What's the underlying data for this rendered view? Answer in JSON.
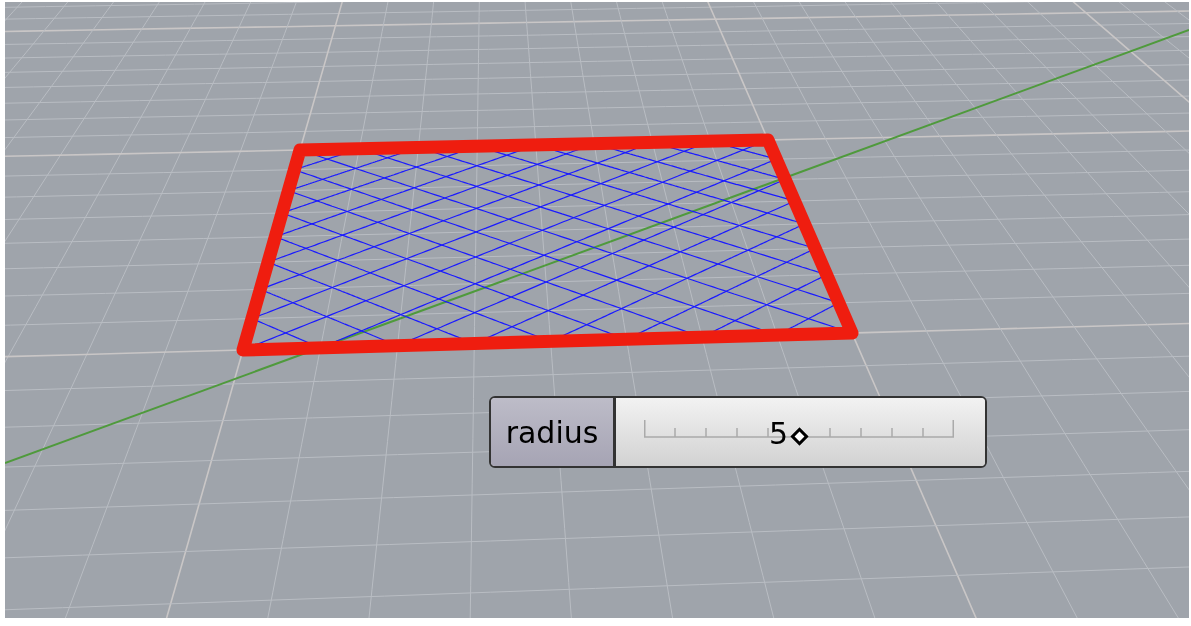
{
  "slider": {
    "label": "radius",
    "value": "5",
    "level": 0.5
  }
}
